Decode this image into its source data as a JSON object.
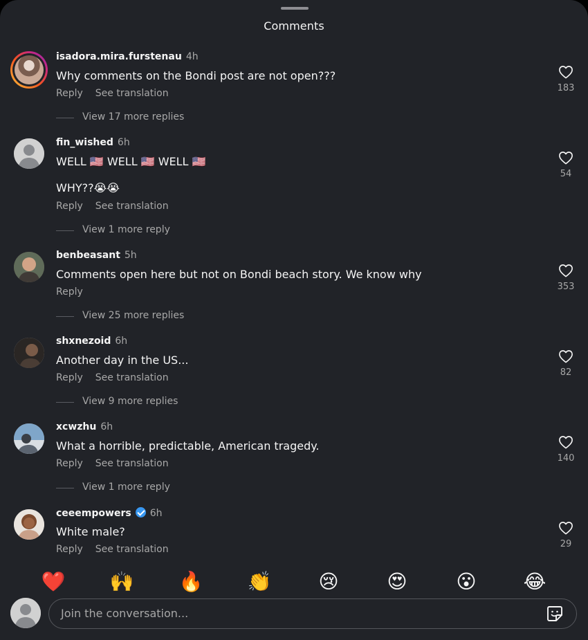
{
  "header": {
    "title": "Comments"
  },
  "comments": [
    {
      "username": "isadora.mira.furstenau",
      "time": "4h",
      "lines": [
        "Why comments on the Bondi post are not open???"
      ],
      "reply": "Reply",
      "translate": "See translation",
      "view_replies": "View 17 more replies",
      "likes": "183"
    },
    {
      "username": "fin_wished",
      "time": "6h",
      "lines": [
        "WELL 🇺🇸 WELL 🇺🇸 WELL 🇺🇸",
        "WHY??😭😭"
      ],
      "reply": "Reply",
      "translate": "See translation",
      "view_replies": "View 1 more reply",
      "likes": "54"
    },
    {
      "username": "benbeasant",
      "time": "5h",
      "lines": [
        "Comments open here but not on Bondi beach story. We know why"
      ],
      "reply": "Reply",
      "view_replies": "View 25 more replies",
      "likes": "353"
    },
    {
      "username": "shxnezoid",
      "time": "6h",
      "lines": [
        "Another day in the US..."
      ],
      "reply": "Reply",
      "translate": "See translation",
      "view_replies": "View 9 more replies",
      "likes": "82"
    },
    {
      "username": "xcwzhu",
      "time": "6h",
      "lines": [
        "What a horrible, predictable, American tragedy."
      ],
      "reply": "Reply",
      "translate": "See translation",
      "view_replies": "View 1 more reply",
      "likes": "140"
    },
    {
      "username": "ceeempowers",
      "verified": true,
      "time": "6h",
      "lines": [
        "White male?"
      ],
      "reply": "Reply",
      "translate": "See translation",
      "likes": "29"
    }
  ],
  "emoji_bar": [
    "❤️",
    "🙌",
    "🔥",
    "👏",
    "😢",
    "😍",
    "😮",
    "😂"
  ],
  "composer": {
    "placeholder": "Join the conversation..."
  },
  "icons": {
    "like": "heart-outline-icon",
    "sticker": "sticker-icon",
    "default_avatar": "person-silhouette-icon",
    "verified": "verified-badge-icon"
  },
  "colors": {
    "background": "#212328",
    "text": "#f5f5f5",
    "secondary": "#a8a8a8",
    "verified": "#3897f0",
    "heart": "#ff3040"
  }
}
